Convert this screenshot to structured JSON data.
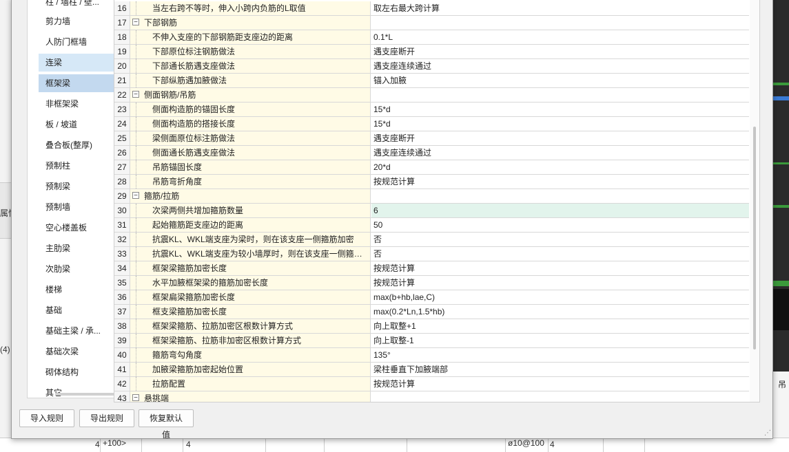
{
  "background": {
    "left_texts": [
      "属性",
      "(4)"
    ],
    "right_text": "吊",
    "bottom_cells": [
      "+100>",
      "4",
      "ø10@100",
      "4"
    ]
  },
  "categories": {
    "items": [
      {
        "label": "柱 / 墙柱 / 壁..."
      },
      {
        "label": "剪力墙"
      },
      {
        "label": "人防门框墙"
      },
      {
        "label": "连梁"
      },
      {
        "label": "框架梁"
      },
      {
        "label": "非框架梁"
      },
      {
        "label": "板 / 坡道"
      },
      {
        "label": "叠合板(整厚)"
      },
      {
        "label": "预制柱"
      },
      {
        "label": "预制梁"
      },
      {
        "label": "预制墙"
      },
      {
        "label": "空心楼盖板"
      },
      {
        "label": "主肋梁"
      },
      {
        "label": "次肋梁"
      },
      {
        "label": "楼梯"
      },
      {
        "label": "基础"
      },
      {
        "label": "基础主梁 / 承..."
      },
      {
        "label": "基础次梁"
      },
      {
        "label": "砌体结构"
      },
      {
        "label": "其它"
      }
    ]
  },
  "grid": {
    "rows": [
      {
        "num": "16",
        "name": "当左右跨不等时，伸入小跨内负筋的L取值",
        "value": "取左右最大跨计算"
      },
      {
        "num": "17",
        "name": "下部钢筋",
        "value": "",
        "group": true,
        "toggle": "−"
      },
      {
        "num": "18",
        "name": "不伸入支座的下部钢筋距支座边的距离",
        "value": "0.1*L"
      },
      {
        "num": "19",
        "name": "下部原位标注钢筋做法",
        "value": "遇支座断开"
      },
      {
        "num": "20",
        "name": "下部通长筋遇支座做法",
        "value": "遇支座连续通过"
      },
      {
        "num": "21",
        "name": "下部纵筋遇加腋做法",
        "value": "锚入加腋"
      },
      {
        "num": "22",
        "name": "侧面钢筋/吊筋",
        "value": "",
        "group": true,
        "toggle": "−"
      },
      {
        "num": "23",
        "name": "侧面构造筋的锚固长度",
        "value": "15*d"
      },
      {
        "num": "24",
        "name": "侧面构造筋的搭接长度",
        "value": "15*d"
      },
      {
        "num": "25",
        "name": "梁侧面原位标注筋做法",
        "value": "遇支座断开"
      },
      {
        "num": "26",
        "name": "侧面通长筋遇支座做法",
        "value": "遇支座连续通过"
      },
      {
        "num": "27",
        "name": "吊筋锚固长度",
        "value": "20*d"
      },
      {
        "num": "28",
        "name": "吊筋弯折角度",
        "value": "按规范计算"
      },
      {
        "num": "29",
        "name": "箍筋/拉筋",
        "value": "",
        "group": true,
        "toggle": "−"
      },
      {
        "num": "30",
        "name": "次梁两侧共增加箍筋数量",
        "value": "6",
        "highlight": true
      },
      {
        "num": "31",
        "name": "起始箍筋距支座边的距离",
        "value": "50"
      },
      {
        "num": "32",
        "name": "抗震KL、WKL端支座为梁时，则在该支座一侧箍筋加密",
        "value": "否"
      },
      {
        "num": "33",
        "name": "抗震KL、WKL端支座为较小墙厚时，则在该支座一侧箍筋加密",
        "value": "否"
      },
      {
        "num": "34",
        "name": "框架梁箍筋加密长度",
        "value": "按规范计算"
      },
      {
        "num": "35",
        "name": "水平加腋框架梁的箍筋加密长度",
        "value": "按规范计算"
      },
      {
        "num": "36",
        "name": "框架扁梁箍筋加密长度",
        "value": "max(b+hb,lae,C)"
      },
      {
        "num": "37",
        "name": "框支梁箍筋加密长度",
        "value": "max(0.2*Ln,1.5*hb)"
      },
      {
        "num": "38",
        "name": "框架梁箍筋、拉筋加密区根数计算方式",
        "value": "向上取整+1"
      },
      {
        "num": "39",
        "name": "框架梁箍筋、拉筋非加密区根数计算方式",
        "value": "向上取整-1"
      },
      {
        "num": "40",
        "name": "箍筋弯勾角度",
        "value": "135°"
      },
      {
        "num": "41",
        "name": "加腋梁箍筋加密起始位置",
        "value": "梁柱垂直下加腋端部"
      },
      {
        "num": "42",
        "name": "拉筋配置",
        "value": "按规范计算"
      },
      {
        "num": "43",
        "name": "悬挑端",
        "value": "",
        "group": true,
        "toggle": "−"
      }
    ]
  },
  "buttons": {
    "import": "导入规则",
    "export": "导出规则",
    "restore": "恢复默认值"
  },
  "colors": {
    "name_column_bg": "#fffbe6",
    "selected_category": "#c3d9ef",
    "highlight_value": "#e2f4ec"
  }
}
